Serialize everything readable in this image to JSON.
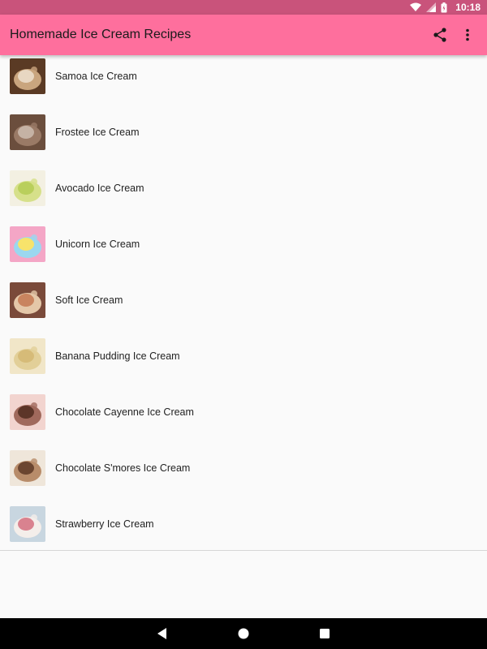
{
  "status_bar": {
    "time": "10:18"
  },
  "app_bar": {
    "title": "Homemade Ice Cream Recipes",
    "share_icon": "share-icon",
    "more_icon": "more-vert-icon"
  },
  "recipes": [
    {
      "label": "Samoa Ice Cream",
      "thumb_colors": [
        "#5a3a24",
        "#c9a57e",
        "#e8d7c2"
      ]
    },
    {
      "label": "Frostee Ice Cream",
      "thumb_colors": [
        "#6b4e3d",
        "#9a7a66",
        "#c5b2a4"
      ]
    },
    {
      "label": "Avocado Ice Cream",
      "thumb_colors": [
        "#f3f0e2",
        "#d6e08a",
        "#b9cf5c"
      ]
    },
    {
      "label": "Unicorn Ice Cream",
      "thumb_colors": [
        "#f4a6c6",
        "#9bd7ef",
        "#f7e36b"
      ]
    },
    {
      "label": "Soft Ice Cream",
      "thumb_colors": [
        "#7a4a3a",
        "#e4c7a8",
        "#c9845f"
      ]
    },
    {
      "label": "Banana Pudding Ice Cream",
      "thumb_colors": [
        "#f1e6c8",
        "#e2cf98",
        "#d6bb78"
      ]
    },
    {
      "label": "Chocolate Cayenne Ice Cream",
      "thumb_colors": [
        "#f2d4cf",
        "#a0695c",
        "#5c3528"
      ]
    },
    {
      "label": "Chocolate S'mores Ice Cream",
      "thumb_colors": [
        "#efe6da",
        "#b88c6a",
        "#6b4530"
      ]
    },
    {
      "label": "Strawberry Ice Cream",
      "thumb_colors": [
        "#c8d6e0",
        "#f4eeea",
        "#d9828f"
      ]
    }
  ],
  "nav_bar": {
    "back_icon": "back-icon",
    "home_icon": "home-icon",
    "recents_icon": "recents-icon"
  },
  "colors": {
    "status_bar": "#c9537b",
    "app_bar": "#fe6f9d",
    "background": "#fafafa"
  }
}
